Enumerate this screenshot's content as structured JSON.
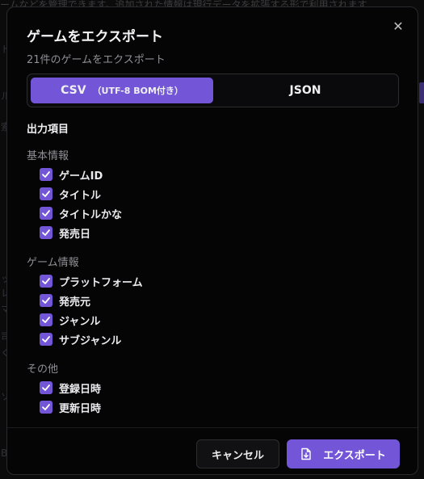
{
  "background": {
    "top_text": "ームなどを管理できます。追加された情報は現行データを拡張する形で利用されます",
    "fragments": [
      "ド",
      "ル",
      "索",
      "ッ",
      "レ",
      "マ",
      "司",
      "ぐ",
      "ソ",
      "B"
    ]
  },
  "dialog": {
    "title": "ゲームをエクスポート",
    "subtitle": "21件のゲームをエクスポート",
    "close_icon": "close-icon",
    "format": {
      "csv_label": "CSV",
      "csv_sub": "（UTF-8 BOM付き）",
      "json_label": "JSON",
      "selected": "CSV"
    },
    "section_title": "出力項目",
    "groups": [
      {
        "label": "基本情報",
        "items": [
          "ゲームID",
          "タイトル",
          "タイトルかな",
          "発売日"
        ]
      },
      {
        "label": "ゲーム情報",
        "items": [
          "プラットフォーム",
          "発売元",
          "ジャンル",
          "サブジャンル"
        ]
      },
      {
        "label": "その他",
        "items": [
          "登録日時",
          "更新日時"
        ]
      }
    ],
    "cancel_label": "キャンセル",
    "export_label": "エクスポート",
    "export_icon": "file-download-icon"
  },
  "colors": {
    "accent": "#7356d8",
    "dialog_bg": "#050506",
    "muted_text": "#8f8f95"
  }
}
